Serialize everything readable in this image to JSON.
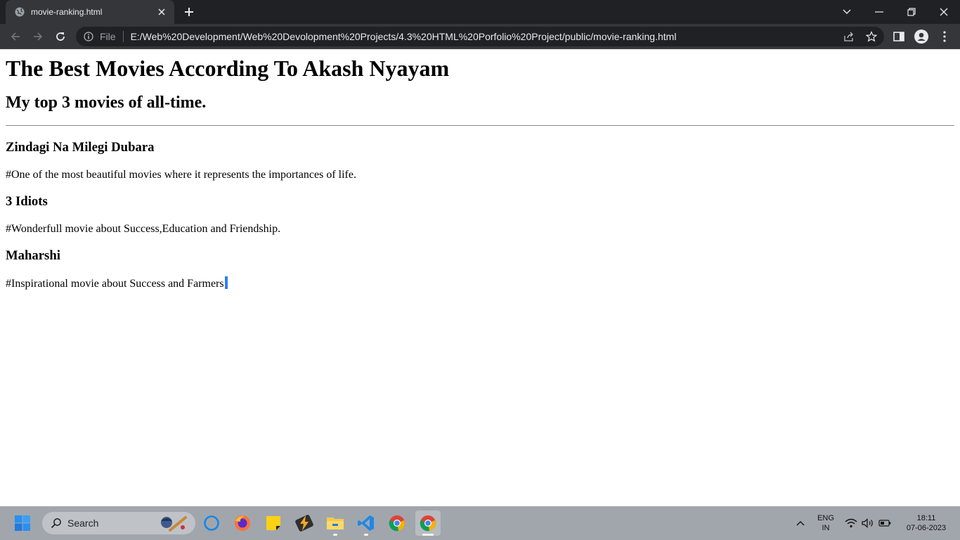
{
  "browser": {
    "tab": {
      "title": "movie-ranking.html"
    },
    "address_bar": {
      "scheme_label": "File",
      "url": "E:/Web%20Development/Web%20Devolopment%20Projects/4.3%20HTML%20Porfolio%20Project/public/movie-ranking.html"
    }
  },
  "page": {
    "heading": "The Best Movies According To Akash Nyayam",
    "subheading": "My top 3 movies of all-time.",
    "movies": [
      {
        "title": "Zindagi Na Milegi Dubara",
        "description": "#One of the most beautiful movies where it represents the importances of life."
      },
      {
        "title": "3 Idiots",
        "description": "#Wonderfull movie about Success,Education and Friendship."
      },
      {
        "title": "Maharshi",
        "description": "#Inspirational movie about Success and Farmers"
      }
    ]
  },
  "taskbar": {
    "search_label": "Search",
    "language": {
      "line1": "ENG",
      "line2": "IN"
    },
    "clock": {
      "time": "18:11",
      "date": "07-06-2023"
    }
  },
  "colors": {
    "chrome_dark": "#202124",
    "chrome_toolbar": "#35363a",
    "taskbar_bg": "#a1a6ac",
    "text_caret": "#2f80ed"
  }
}
